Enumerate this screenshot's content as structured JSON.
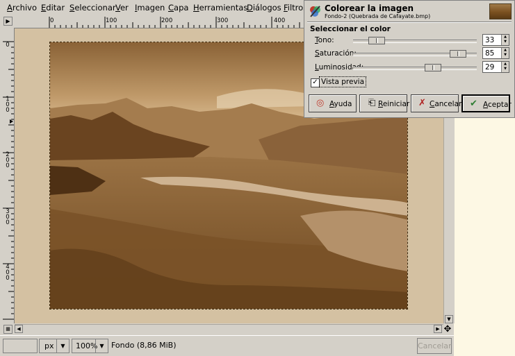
{
  "menu": [
    "Archivo",
    "Editar",
    "Seleccionar",
    "Ver",
    "Imagen",
    "Capa",
    "Herramientas",
    "Diálogos",
    "Filtros"
  ],
  "ruler": {
    "h_labels": [
      "0",
      "100",
      "200",
      "300",
      "400"
    ],
    "v_labels": [
      "0",
      "100",
      "200",
      "300",
      "400"
    ]
  },
  "status": {
    "unit": "px",
    "zoom": "100%",
    "layer_info": "Fondo (8,86 MiB)",
    "cancel_label": "Cancelar"
  },
  "dialog": {
    "title": "Colorear la imagen",
    "subtitle": "Fondo-2 (Quebrada de Cafayate.bmp)",
    "section": "Seleccionar el color",
    "sliders": [
      {
        "label": "Tono:",
        "value": "33",
        "fraction": 0.19
      },
      {
        "label": "Saturación:",
        "value": "85",
        "fraction": 0.85
      },
      {
        "label": "Luminosidad:",
        "value": "29",
        "fraction": 0.645
      }
    ],
    "preview_label": "Vista previa",
    "preview_checked": true,
    "buttons": [
      {
        "label": "Ayuda",
        "icon": "help-icon"
      },
      {
        "label": "Reiniciar",
        "icon": "reset-icon"
      },
      {
        "label": "Cancelar",
        "icon": "cancel-x-icon"
      },
      {
        "label": "Aceptar",
        "icon": "accept-icon"
      }
    ]
  },
  "colors": {
    "sepia_tint": "#8b5a22",
    "canvas_bg": "#d4c1a2",
    "window_bg": "#d4d0c8"
  }
}
